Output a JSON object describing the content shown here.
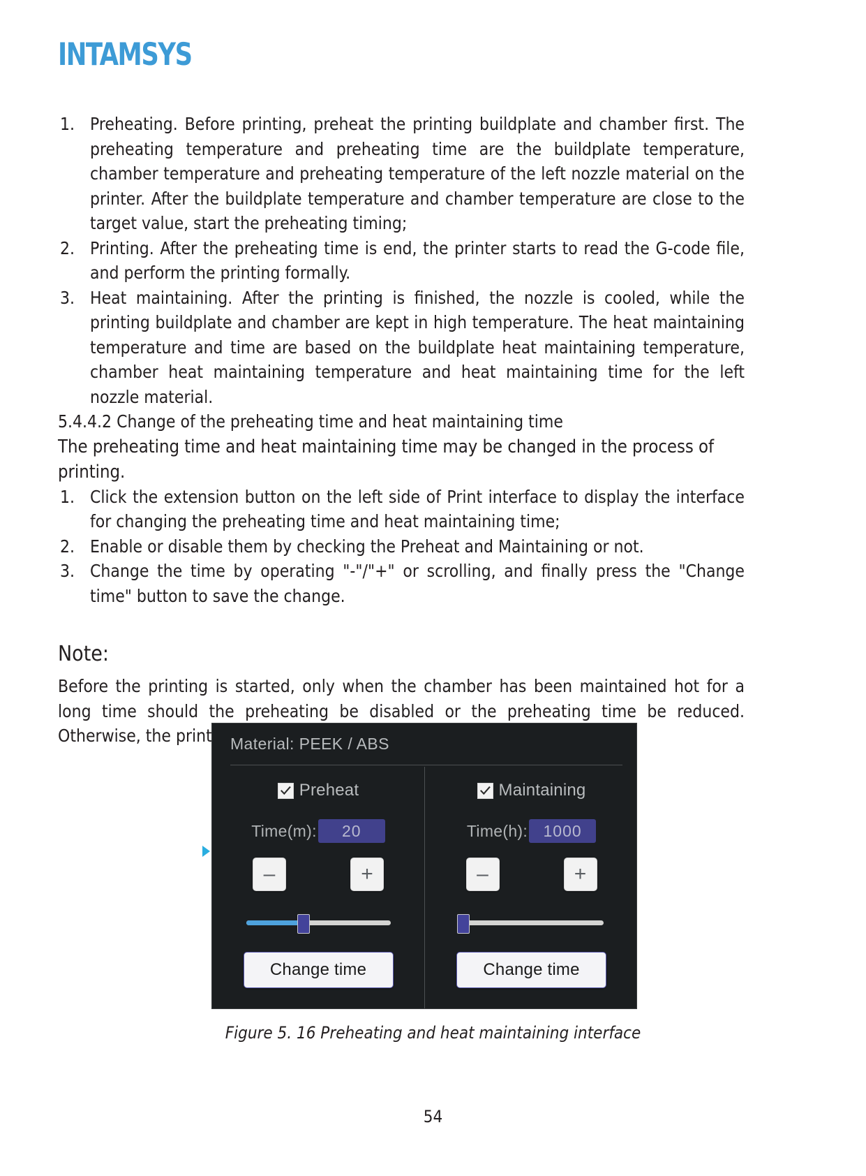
{
  "brand": {
    "logo_text": "INTAMSYS"
  },
  "sections": {
    "list_one": [
      {
        "marker": "1.",
        "text": "Preheating. Before printing, preheat the printing buildplate and chamber first. The preheating temperature and preheating time are the buildplate temperature, chamber temperature and preheating temperature of the left nozzle material on the printer. After the buildplate temperature and chamber temperature are close to the target value, start the preheating timing;"
      },
      {
        "marker": "2.",
        "text": "Printing. After the preheating time is end, the printer starts to read the G-code file, and perform the printing formally."
      },
      {
        "marker": "3.",
        "text": "Heat maintaining. After the printing is finished, the nozzle is cooled, while the printing buildplate and chamber are kept in high temperature. The heat maintaining temperature and time are based on the buildplate heat maintaining temperature, chamber heat maintaining temperature and heat maintaining time for the left nozzle material."
      }
    ],
    "subsection_heading": "5.4.4.2 Change of the preheating time and heat maintaining time",
    "emphasis_line": "The preheating time and heat maintaining time may be changed in the process of printing.",
    "list_two": [
      {
        "marker": "1.",
        "text": "Click the extension button on the left side of Print interface to display the interface for changing the preheating time and heat maintaining time;"
      },
      {
        "marker": "2.",
        "text": "Enable or disable them by checking the Preheat and Maintaining or not."
      },
      {
        "marker": "3.",
        "text": "Change the time by operating \"-\"/\"+\" or scrolling, and finally press the \"Change time\" button to save the change."
      }
    ],
    "note_heading": "Note:",
    "note_body": "Before the printing is started, only when the chamber has been maintained hot for a long time should the preheating be disabled or the preheating time be reduced. Otherwise, the printing quality next time will be impacted."
  },
  "figure": {
    "caption": "Figure 5. 16 Preheating and heat maintaining interface",
    "ui": {
      "material_label": "Material: PEEK / ABS",
      "colors": {
        "panel_bg": "#1b1e20",
        "value_box": "#41418c",
        "slider_fill": "#4ea2dd",
        "slider_handle": "#43439a",
        "arrow": "#2aaee0"
      },
      "columns": [
        {
          "checkbox_label": "Preheat",
          "checked": true,
          "time_label": "Time(m):",
          "time_value": "20",
          "minus_label": "–",
          "plus_label": "+",
          "slider_percent": 40,
          "change_label": "Change time"
        },
        {
          "checkbox_label": "Maintaining",
          "checked": true,
          "time_label": "Time(h):",
          "time_value": "1000",
          "minus_label": "–",
          "plus_label": "+",
          "slider_percent": 3,
          "change_label": "Change time"
        }
      ]
    }
  },
  "footer": {
    "page_number": "54"
  }
}
